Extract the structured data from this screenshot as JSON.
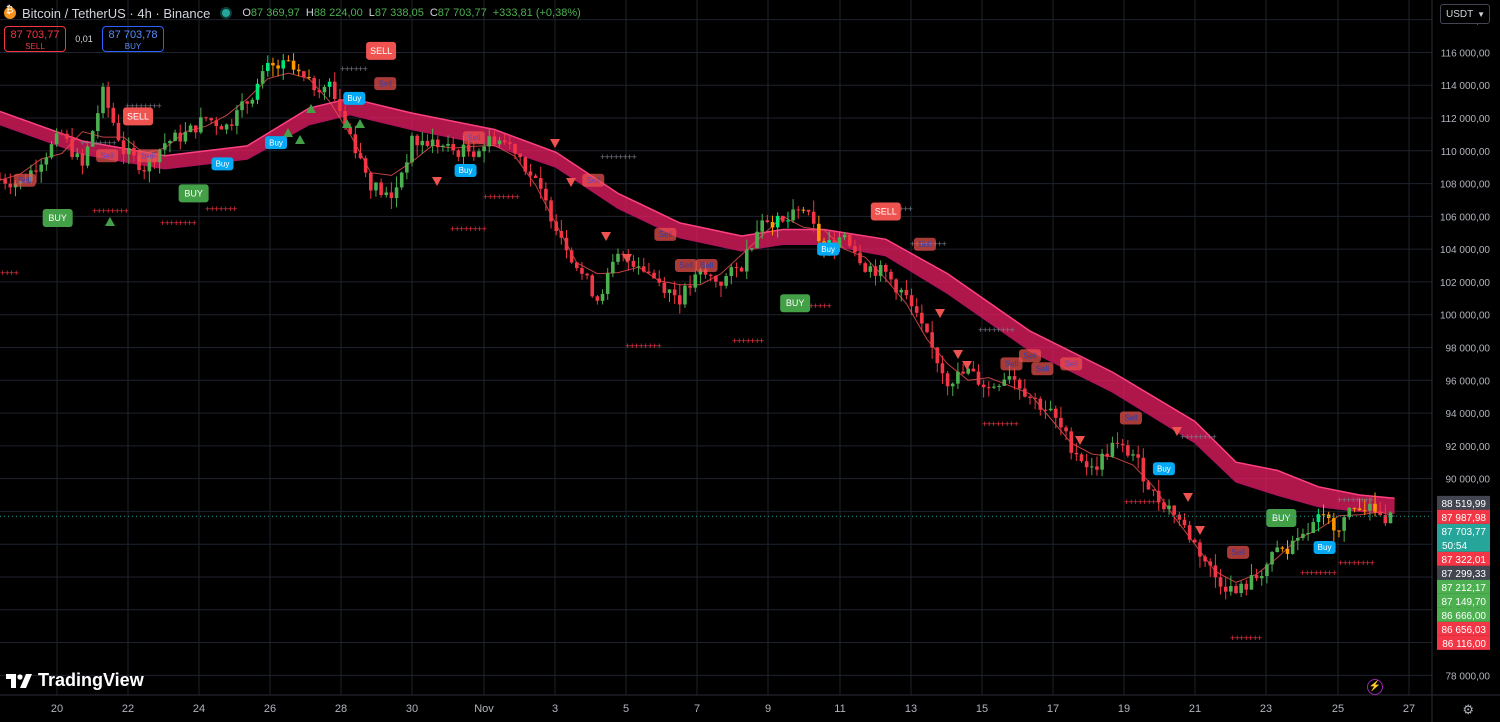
{
  "header": {
    "title": "Bitcoin / TetherUS · 4h · Binance",
    "ohlc": [
      {
        "k": "O",
        "v": "87 369,97"
      },
      {
        "k": "H",
        "v": "88 224,00"
      },
      {
        "k": "L",
        "v": "87 338,05"
      },
      {
        "k": "C",
        "v": "87 703,77"
      }
    ],
    "change": "+333,81 (+0,38%)"
  },
  "trade": {
    "sell_price": "87 703,77",
    "sell_label": "SELL",
    "spread": "0,01",
    "buy_price": "87 703,78",
    "buy_label": "BUY"
  },
  "currency": "USDT",
  "brand": "TradingView",
  "colors": {
    "bull": "#4caf50",
    "bear": "#f23645",
    "bull_bright": "#00e676",
    "band": "#e91e63",
    "buy_tag": "#43a047",
    "sell_tag": "#ef5350",
    "blue_tag": "#03a9f4"
  },
  "chart_data": {
    "type": "candlestick",
    "ylim": [
      76800,
      119200
    ],
    "y_ticks": [
      "78 000,00",
      "80 000,00",
      "82 000,00",
      "84 000,00",
      "86 000,00",
      "88 000,00",
      "90 000,00",
      "92 000,00",
      "94 000,00",
      "96 000,00",
      "98 000,00",
      "100 000,00",
      "102 000,00",
      "104 000,00",
      "106 000,00",
      "108 000,00",
      "110 000,00",
      "112 000,00",
      "114 000,00",
      "116 000,00",
      "118 000,00"
    ],
    "x_ticks": [
      "20",
      "22",
      "24",
      "26",
      "28",
      "30",
      "Nov",
      "3",
      "5",
      "7",
      "9",
      "11",
      "13",
      "15",
      "17",
      "19",
      "21",
      "23",
      "25",
      "27"
    ],
    "path": [
      [
        0,
        108300
      ],
      [
        1,
        108000
      ],
      [
        2,
        109500
      ],
      [
        3,
        111000
      ],
      [
        4,
        109000
      ],
      [
        5,
        113500
      ],
      [
        6,
        110000
      ],
      [
        7,
        109000
      ],
      [
        8,
        110500
      ],
      [
        9,
        111000
      ],
      [
        10,
        112000
      ],
      [
        11,
        111500
      ],
      [
        12,
        113000
      ],
      [
        13,
        115000
      ],
      [
        14,
        115200
      ],
      [
        15,
        114000
      ],
      [
        16,
        114000
      ],
      [
        17,
        111000
      ],
      [
        18,
        108000
      ],
      [
        19,
        107000
      ],
      [
        20,
        110500
      ],
      [
        21,
        110500
      ],
      [
        22,
        110000
      ],
      [
        23,
        110000
      ],
      [
        24,
        110800
      ],
      [
        25,
        110200
      ],
      [
        26,
        108000
      ],
      [
        27,
        105500
      ],
      [
        28,
        103000
      ],
      [
        29,
        101000
      ],
      [
        30,
        103500
      ],
      [
        31,
        103200
      ],
      [
        32,
        102000
      ],
      [
        33,
        101000
      ],
      [
        34,
        102500
      ],
      [
        35,
        102000
      ],
      [
        36,
        103000
      ],
      [
        37,
        106000
      ],
      [
        38,
        105500
      ],
      [
        39,
        106500
      ],
      [
        40,
        104000
      ],
      [
        41,
        105000
      ],
      [
        42,
        103000
      ],
      [
        43,
        102500
      ],
      [
        44,
        101000
      ],
      [
        45,
        98500
      ],
      [
        46,
        96000
      ],
      [
        47,
        96500
      ],
      [
        48,
        95500
      ],
      [
        49,
        96500
      ],
      [
        50,
        95000
      ],
      [
        51,
        94000
      ],
      [
        52,
        92000
      ],
      [
        53,
        90500
      ],
      [
        54,
        92000
      ],
      [
        55,
        91500
      ],
      [
        56,
        89000
      ],
      [
        57,
        88000
      ],
      [
        58,
        86000
      ],
      [
        59,
        84000
      ],
      [
        60,
        83000
      ],
      [
        61,
        84000
      ],
      [
        62,
        85500
      ],
      [
        63,
        86000
      ],
      [
        64,
        87500
      ],
      [
        65,
        87200
      ],
      [
        66,
        88500
      ],
      [
        67,
        87700
      ],
      [
        67.7,
        87703.77
      ]
    ],
    "band_upper": [
      [
        0,
        112400
      ],
      [
        4,
        110600
      ],
      [
        8,
        109700
      ],
      [
        12,
        110300
      ],
      [
        15,
        112600
      ],
      [
        17,
        113200
      ],
      [
        20,
        112300
      ],
      [
        24,
        111300
      ],
      [
        27,
        109900
      ],
      [
        30,
        107400
      ],
      [
        33,
        105600
      ],
      [
        36,
        104800
      ],
      [
        38,
        105200
      ],
      [
        40,
        105200
      ],
      [
        43,
        104600
      ],
      [
        46,
        102500
      ],
      [
        50,
        99000
      ],
      [
        54,
        96500
      ],
      [
        58,
        93500
      ],
      [
        60,
        91000
      ],
      [
        62,
        90500
      ],
      [
        64,
        89500
      ],
      [
        66,
        89000
      ],
      [
        67.7,
        88800
      ]
    ],
    "band_lower": [
      [
        0,
        111600
      ],
      [
        4,
        109800
      ],
      [
        8,
        108900
      ],
      [
        12,
        109500
      ],
      [
        15,
        111600
      ],
      [
        17,
        112200
      ],
      [
        20,
        111300
      ],
      [
        24,
        110300
      ],
      [
        27,
        109000
      ],
      [
        30,
        106500
      ],
      [
        33,
        104700
      ],
      [
        36,
        103900
      ],
      [
        38,
        104300
      ],
      [
        40,
        104300
      ],
      [
        43,
        103600
      ],
      [
        46,
        101300
      ],
      [
        50,
        97800
      ],
      [
        54,
        95300
      ],
      [
        58,
        92200
      ],
      [
        60,
        89800
      ],
      [
        62,
        89000
      ],
      [
        64,
        88300
      ],
      [
        66,
        88000
      ],
      [
        67.7,
        87900
      ]
    ],
    "signals": [
      {
        "label": "SELL",
        "x": 6.7,
        "y": 112100,
        "kind": "sell"
      },
      {
        "label": "SELL",
        "x": 18.5,
        "y": 116100,
        "kind": "sell"
      },
      {
        "label": "SELL",
        "x": 43,
        "y": 106300,
        "kind": "sell"
      },
      {
        "label": "BUY",
        "x": 2.8,
        "y": 105900,
        "kind": "buy"
      },
      {
        "label": "BUY",
        "x": 9.4,
        "y": 107400,
        "kind": "buy"
      },
      {
        "label": "BUY",
        "x": 38.6,
        "y": 100700,
        "kind": "buy"
      },
      {
        "label": "BUY",
        "x": 62.2,
        "y": 87600,
        "kind": "buy"
      },
      {
        "label": "Sell",
        "x": 1.2,
        "y": 108200,
        "kind": "faint"
      },
      {
        "label": "Sell",
        "x": 5.2,
        "y": 109700,
        "kind": "faint"
      },
      {
        "label": "Sell",
        "x": 7.2,
        "y": 109700,
        "kind": "faint"
      },
      {
        "label": "Sell",
        "x": 18.7,
        "y": 114100,
        "kind": "faint"
      },
      {
        "label": "Sell",
        "x": 23,
        "y": 110800,
        "kind": "faint"
      },
      {
        "label": "Sell",
        "x": 28.8,
        "y": 108200,
        "kind": "faint"
      },
      {
        "label": "Sell",
        "x": 32.3,
        "y": 104900,
        "kind": "faint"
      },
      {
        "label": "Sell",
        "x": 33.3,
        "y": 103000,
        "kind": "faint"
      },
      {
        "label": "Sell",
        "x": 34.3,
        "y": 103000,
        "kind": "faint"
      },
      {
        "label": "Sell",
        "x": 44.9,
        "y": 104300,
        "kind": "faint"
      },
      {
        "label": "Sell",
        "x": 49.1,
        "y": 97000,
        "kind": "faint"
      },
      {
        "label": "Sell",
        "x": 50,
        "y": 97500,
        "kind": "faint"
      },
      {
        "label": "Sell",
        "x": 50.6,
        "y": 96700,
        "kind": "faint"
      },
      {
        "label": "Sell",
        "x": 52,
        "y": 97000,
        "kind": "faint"
      },
      {
        "label": "Sell",
        "x": 54.9,
        "y": 93700,
        "kind": "faint"
      },
      {
        "label": "Sell",
        "x": 60.1,
        "y": 85500,
        "kind": "faint"
      },
      {
        "label": "Buy",
        "x": 10.8,
        "y": 109200,
        "kind": "blue"
      },
      {
        "label": "Buy",
        "x": 13.4,
        "y": 110500,
        "kind": "blue"
      },
      {
        "label": "Buy",
        "x": 17.2,
        "y": 113200,
        "kind": "blue"
      },
      {
        "label": "Buy",
        "x": 22.6,
        "y": 108800,
        "kind": "blue"
      },
      {
        "label": "Buy",
        "x": 40.2,
        "y": 104000,
        "kind": "blue"
      },
      {
        "label": "Buy",
        "x": 56.5,
        "y": 90600,
        "kind": "blue"
      },
      {
        "label": "Buy",
        "x": 64.3,
        "y": 85800,
        "kind": "blue"
      }
    ],
    "price_tags": [
      {
        "text": "88 519,99",
        "y": 88519.99,
        "bg": "#434651",
        "fg": "#ffffff"
      },
      {
        "text": "87 987,98",
        "y": 87987.98,
        "bg": "#f23645",
        "fg": "#ffffff"
      },
      {
        "text": "87 703,77",
        "y": 87703.77,
        "bg": "#26a69a",
        "fg": "#ffffff",
        "sub": "50:54"
      },
      {
        "text": "87 322,01",
        "y": 87322.01,
        "bg": "#f23645",
        "fg": "#ffffff"
      },
      {
        "text": "87 299,33",
        "y": 87299.33,
        "bg": "#434651",
        "fg": "#ffffff"
      },
      {
        "text": "87 212,17",
        "y": 87212.17,
        "bg": "#4caf50",
        "fg": "#ffffff"
      },
      {
        "text": "87 149,70",
        "y": 87149.7,
        "bg": "#4caf50",
        "fg": "#ffffff"
      },
      {
        "text": "86 666,00",
        "y": 86666.0,
        "bg": "#4caf50",
        "fg": "#ffffff"
      },
      {
        "text": "86 656,03",
        "y": 86656.03,
        "bg": "#f23645",
        "fg": "#ffffff"
      },
      {
        "text": "86 116,00",
        "y": 86116.0,
        "bg": "#f23645",
        "fg": "#ffffff"
      }
    ]
  }
}
